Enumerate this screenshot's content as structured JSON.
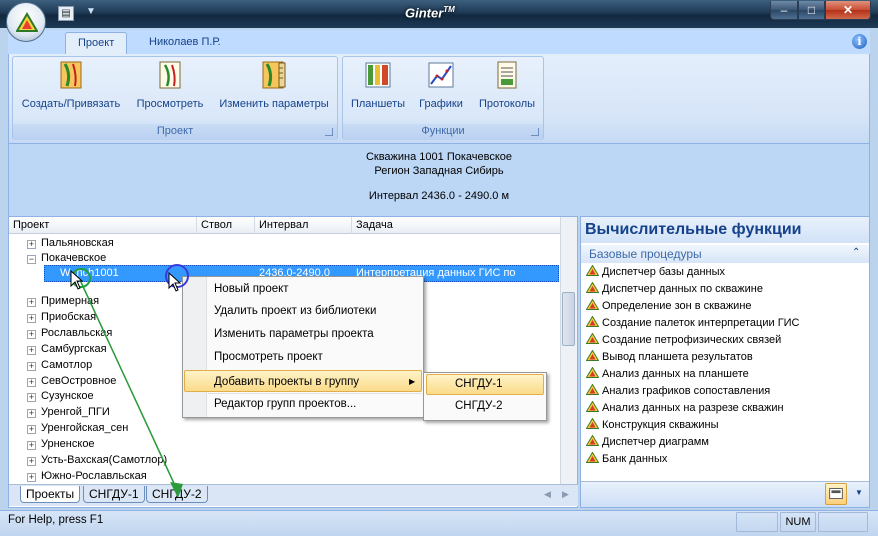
{
  "window": {
    "title": "Ginter",
    "title_suffix": "TM",
    "min": "–",
    "max": "□",
    "close": "✕"
  },
  "ribbon": {
    "tabs": [
      {
        "label": "Проект"
      },
      {
        "label": "Николаев П.Р."
      }
    ],
    "groups": [
      {
        "label": "Проект",
        "buttons": [
          {
            "label": "Создать/Привязать"
          },
          {
            "label": "Просмотреть"
          },
          {
            "label": "Изменить параметры"
          }
        ]
      },
      {
        "label": "Функции",
        "buttons": [
          {
            "label": "Планшеты"
          },
          {
            "label": "Графики"
          },
          {
            "label": "Протоколы"
          }
        ]
      }
    ]
  },
  "info": {
    "well": "Скважина 1001 Покачевское",
    "region": "Регион Западная Сибирь",
    "interval": "Интервал 2436.0 - 2490.0 м"
  },
  "tree": {
    "columns": [
      "Проект",
      "Ствол",
      "Интервал",
      "Задача"
    ],
    "items_top": [
      "Пальяновская",
      "Покачевское"
    ],
    "selected": {
      "name": "W_nch1001",
      "interval": "2436.0-2490.0",
      "task": "Интерпретация данных ГИС по"
    },
    "items": [
      "Примерная",
      "Приобская",
      "Рославльская",
      "Самбургская",
      "Самотлор",
      "СевОстровное",
      "Сузунское",
      "Уренгой_ПГИ",
      "Уренгойская_сен",
      "Урненское",
      "Усть-Вахская(Самотлор)",
      "Южно-Рославльская"
    ],
    "bottom_tabs": [
      "Проекты",
      "СНГДУ-1",
      "СНГДУ-2"
    ]
  },
  "context_menu": {
    "items": [
      "Новый проект",
      "Удалить проект из библиотеки",
      "Изменить параметры проекта",
      "Просмотреть проект",
      "Добавить проекты в группу",
      "Редактор групп проектов..."
    ],
    "arrow": "▶",
    "submenu": [
      "СНГДУ-1",
      "СНГДУ-2"
    ]
  },
  "right_panel": {
    "title": "Вычислительные функции",
    "group": "Базовые процедуры",
    "items": [
      "Диспетчер базы данных",
      "Диспетчер данных по скважине",
      "Определение зон в скважине",
      "Создание палеток интерпретации ГИС",
      "Создание петрофизических связей",
      "Вывод планшета результатов",
      "Анализ данных на планшете",
      "Анализ графиков сопоставления",
      "Анализ данных на разрезе скважин",
      "Конструкция скважины",
      "Диспетчер диаграмм",
      "Банк данных"
    ]
  },
  "status": {
    "text": "For Help, press F1",
    "num": "NUM"
  },
  "colors": {
    "accent": "#15428b",
    "selection": "#3399ff",
    "highlight": "#fbdb8a"
  }
}
